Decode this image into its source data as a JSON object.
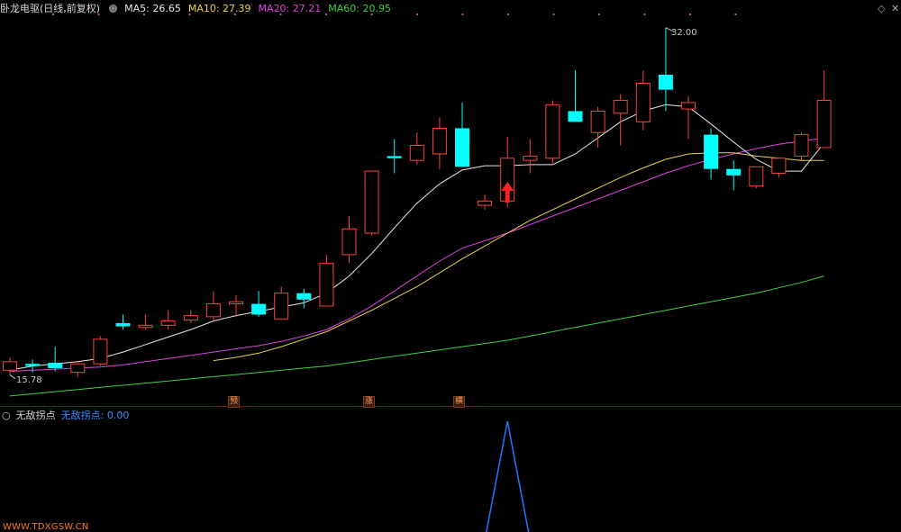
{
  "header": {
    "title": "卧龙电驱",
    "period": "(日线,前复权)",
    "ma_items": [
      {
        "label": "MA5:",
        "value": "26.65",
        "color": "#e8e8e8"
      },
      {
        "label": "MA10:",
        "value": "27.39",
        "color": "#e8d44a"
      },
      {
        "label": "MA20:",
        "value": "27.21",
        "color": "#e040e0"
      },
      {
        "label": "MA60:",
        "value": "20.95",
        "color": "#40d040"
      }
    ]
  },
  "sub_panel": {
    "title": "无敌拐点",
    "label": "无敌拐点:",
    "value": "0.00",
    "color": "#3a8cff"
  },
  "price_labels": {
    "high": "32.00",
    "low": "15.78"
  },
  "signals": [
    "预",
    "涨",
    "横"
  ],
  "watermark": "WWW.TDXGSW.CN",
  "colors": {
    "up": "#ff4040",
    "down": "#00ffff",
    "ma5": "#e8e8e8",
    "ma10": "#e8d44a",
    "ma20": "#e040e0",
    "ma60": "#40d040",
    "indicator": "#1e78ff"
  },
  "chart_data": {
    "type": "candlestick",
    "y_range_main": [
      14.5,
      32.7
    ],
    "candles": [
      {
        "o": 16.0,
        "h": 16.6,
        "l": 15.78,
        "c": 16.4
      },
      {
        "o": 16.3,
        "h": 16.5,
        "l": 15.9,
        "c": 16.2
      },
      {
        "o": 16.35,
        "h": 17.1,
        "l": 15.95,
        "c": 16.1
      },
      {
        "o": 15.9,
        "h": 16.4,
        "l": 15.7,
        "c": 16.3
      },
      {
        "o": 16.3,
        "h": 17.6,
        "l": 16.2,
        "c": 17.45
      },
      {
        "o": 18.2,
        "h": 18.6,
        "l": 17.9,
        "c": 18.05
      },
      {
        "o": 18.0,
        "h": 18.6,
        "l": 17.9,
        "c": 18.1
      },
      {
        "o": 18.1,
        "h": 18.8,
        "l": 17.9,
        "c": 18.3
      },
      {
        "o": 18.35,
        "h": 18.8,
        "l": 18.2,
        "c": 18.55
      },
      {
        "o": 18.5,
        "h": 19.7,
        "l": 18.3,
        "c": 19.1
      },
      {
        "o": 19.1,
        "h": 19.5,
        "l": 18.5,
        "c": 19.2
      },
      {
        "o": 19.1,
        "h": 19.7,
        "l": 18.5,
        "c": 18.6
      },
      {
        "o": 18.4,
        "h": 19.9,
        "l": 18.4,
        "c": 19.6
      },
      {
        "o": 19.6,
        "h": 19.8,
        "l": 18.9,
        "c": 19.3
      },
      {
        "o": 19.0,
        "h": 21.4,
        "l": 19.0,
        "c": 21.0
      },
      {
        "o": 21.4,
        "h": 23.2,
        "l": 21.0,
        "c": 22.6
      },
      {
        "o": 22.4,
        "h": 24.4,
        "l": 22.3,
        "c": 25.3
      },
      {
        "o": 26.0,
        "h": 26.8,
        "l": 25.2,
        "c": 25.9
      },
      {
        "o": 25.8,
        "h": 27.1,
        "l": 25.6,
        "c": 26.5
      },
      {
        "o": 26.1,
        "h": 27.8,
        "l": 25.4,
        "c": 27.3
      },
      {
        "o": 27.3,
        "h": 28.5,
        "l": 25.9,
        "c": 25.5
      },
      {
        "o": 23.7,
        "h": 24.2,
        "l": 23.5,
        "c": 23.9
      },
      {
        "o": 23.9,
        "h": 26.9,
        "l": 23.6,
        "c": 25.9
      },
      {
        "o": 25.8,
        "h": 26.8,
        "l": 25.2,
        "c": 26.0
      },
      {
        "o": 25.9,
        "h": 28.6,
        "l": 25.6,
        "c": 28.4
      },
      {
        "o": 28.1,
        "h": 30.0,
        "l": 27.7,
        "c": 27.6
      },
      {
        "o": 27.1,
        "h": 28.3,
        "l": 26.4,
        "c": 28.1
      },
      {
        "o": 28.0,
        "h": 28.9,
        "l": 26.5,
        "c": 28.6
      },
      {
        "o": 27.6,
        "h": 30.0,
        "l": 27.2,
        "c": 29.4
      },
      {
        "o": 29.8,
        "h": 32.0,
        "l": 28.1,
        "c": 29.1
      },
      {
        "o": 28.2,
        "h": 28.8,
        "l": 26.8,
        "c": 28.5
      },
      {
        "o": 27.0,
        "h": 27.3,
        "l": 24.9,
        "c": 25.4
      },
      {
        "o": 25.4,
        "h": 25.8,
        "l": 24.4,
        "c": 25.1
      },
      {
        "o": 24.6,
        "h": 25.4,
        "l": 24.5,
        "c": 25.5
      },
      {
        "o": 25.2,
        "h": 25.9,
        "l": 25.0,
        "c": 25.9
      },
      {
        "o": 26.0,
        "h": 27.1,
        "l": 25.8,
        "c": 27.0
      },
      {
        "o": 26.4,
        "h": 30.0,
        "l": 26.4,
        "c": 28.6
      }
    ],
    "ma5": [
      16.0,
      16.2,
      16.3,
      16.4,
      16.55,
      16.85,
      17.2,
      17.55,
      17.9,
      18.3,
      18.55,
      18.75,
      18.95,
      19.15,
      19.6,
      20.4,
      21.45,
      22.65,
      23.8,
      24.7,
      25.35,
      25.55,
      25.55,
      25.6,
      25.6,
      26.1,
      26.85,
      27.6,
      28.1,
      28.4,
      28.3,
      27.5,
      26.65,
      25.85,
      25.3,
      25.3,
      26.6
    ],
    "ma10": [
      null,
      null,
      null,
      null,
      null,
      null,
      null,
      null,
      null,
      16.45,
      16.6,
      16.8,
      17.1,
      17.45,
      17.8,
      18.3,
      18.8,
      19.35,
      19.9,
      20.55,
      21.2,
      21.8,
      22.4,
      23.0,
      23.5,
      24.0,
      24.5,
      25.0,
      25.45,
      25.85,
      26.1,
      26.15,
      26.15,
      26.0,
      25.9,
      25.8,
      25.8
    ],
    "ma20": [
      15.95,
      16.0,
      16.05,
      16.1,
      16.15,
      16.25,
      16.4,
      16.55,
      16.7,
      16.85,
      17.0,
      17.15,
      17.35,
      17.6,
      17.9,
      18.4,
      19.0,
      19.7,
      20.4,
      21.1,
      21.7,
      22.05,
      22.4,
      22.8,
      23.2,
      23.6,
      24.0,
      24.4,
      24.8,
      25.2,
      25.55,
      25.85,
      26.1,
      26.35,
      26.55,
      26.7,
      26.85
    ],
    "ma60": [
      14.8,
      14.9,
      15.0,
      15.1,
      15.2,
      15.3,
      15.4,
      15.5,
      15.6,
      15.7,
      15.8,
      15.9,
      16.0,
      16.1,
      16.2,
      16.35,
      16.5,
      16.65,
      16.8,
      16.95,
      17.1,
      17.25,
      17.4,
      17.6,
      17.8,
      18.0,
      18.2,
      18.4,
      18.6,
      18.8,
      19.0,
      19.2,
      19.4,
      19.6,
      19.85,
      20.1,
      20.4
    ],
    "indicator": {
      "name": "无敌拐点",
      "current": 0.0,
      "values": [
        0,
        0,
        0,
        0,
        0,
        0,
        0,
        0,
        0,
        0,
        0,
        0,
        0,
        0,
        0,
        0,
        0,
        0,
        0,
        0,
        0,
        0,
        1,
        0,
        0,
        0,
        0,
        0,
        0,
        0,
        0,
        0,
        0,
        0,
        0,
        0,
        0
      ]
    }
  }
}
